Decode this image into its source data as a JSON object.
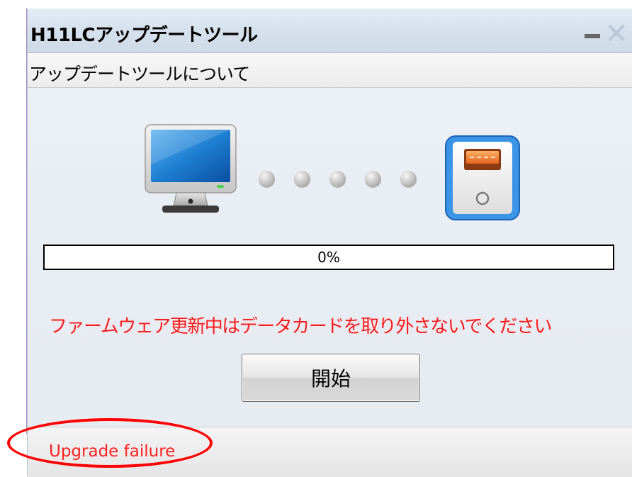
{
  "window": {
    "title": "H11LCアップデートツール",
    "minimize_icon": "minimize-icon",
    "close_icon": "close-icon",
    "close_glyph": "✕"
  },
  "menu": {
    "items": [
      {
        "label": "アップデートツールについて"
      }
    ]
  },
  "connection": {
    "source_icon": "monitor-icon",
    "target_icon": "data-card-icon",
    "dot_count": 5
  },
  "progress": {
    "value": 0,
    "text": "0%"
  },
  "warning_text": "ファームウェア更新中はデータカードを取り外さないでください",
  "start_button_label": "開始",
  "status": {
    "text": "Upgrade failure"
  },
  "colors": {
    "warning": "#ff1c1c",
    "status_text": "#ff2222",
    "annotation": "#ff0000",
    "card_border": "#2f86e0"
  }
}
